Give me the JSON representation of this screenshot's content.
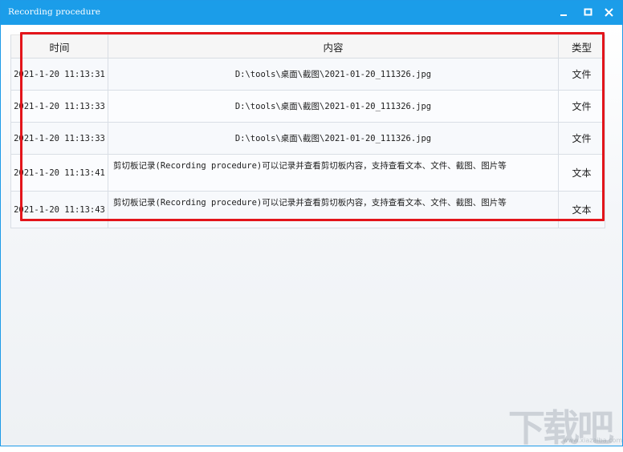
{
  "window": {
    "title": "Recording procedure",
    "titlebar_color": "#1b9de9"
  },
  "controls": {
    "minimize_icon": "minimize-icon",
    "maximize_icon": "maximize-icon",
    "close_icon": "close-icon"
  },
  "table": {
    "headers": [
      "时间",
      "内容",
      "类型"
    ],
    "rows": [
      {
        "time": "2021-1-20 11:13:31",
        "content": "D:\\tools\\桌面\\截图\\2021-01-20_111326.jpg",
        "type": "文件"
      },
      {
        "time": "2021-1-20 11:13:33",
        "content": "D:\\tools\\桌面\\截图\\2021-01-20_111326.jpg",
        "type": "文件"
      },
      {
        "time": "2021-1-20 11:13:33",
        "content": "D:\\tools\\桌面\\截图\\2021-01-20_111326.jpg",
        "type": "文件"
      },
      {
        "time": "2021-1-20 11:13:41",
        "content": "剪切板记录(Recording procedure)可以记录并查看剪切板内容，支持查看文本、文件、截图、图片等",
        "type": "文本"
      },
      {
        "time": "2021-1-20 11:13:43",
        "content": "剪切板记录(Recording procedure)可以记录并查看剪切板内容，支持查看文本、文件、截图、图片等",
        "type": "文本"
      }
    ]
  },
  "annotation": {
    "highlight_color": "#e3151b"
  },
  "watermark": {
    "text": "下载吧",
    "sub": "www.xiazaiba.com"
  }
}
